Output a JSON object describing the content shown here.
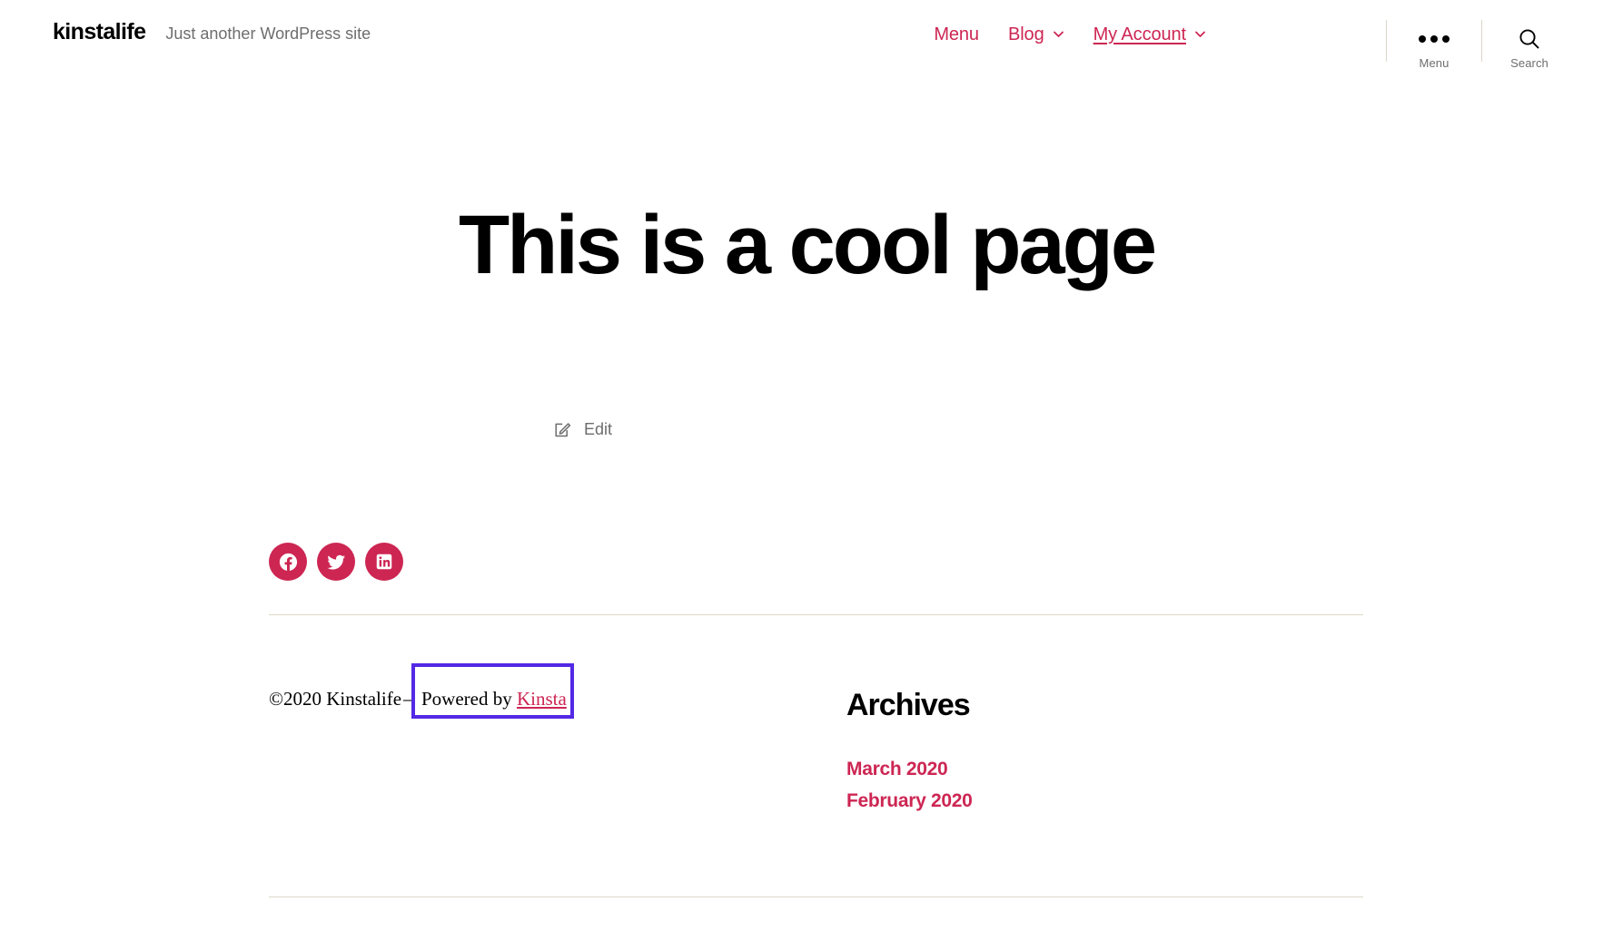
{
  "colors": {
    "accent": "#cd2653",
    "text": "#000000",
    "muted": "#6d6d6d",
    "rule": "#dcd7ca",
    "selection_box": "#5329e5",
    "background": "#ffffff"
  },
  "header": {
    "site_title": "kinstalife",
    "tagline": "Just another WordPress site",
    "nav": [
      {
        "label": "Menu",
        "has_chevron": false,
        "current": false,
        "icon": ""
      },
      {
        "label": "Blog",
        "has_chevron": true,
        "current": false,
        "icon": "chevron-down-icon"
      },
      {
        "label": "My Account",
        "has_chevron": true,
        "current": true,
        "icon": "chevron-down-icon"
      }
    ],
    "toggles": [
      {
        "label": "Menu",
        "icon": "ellipsis-icon"
      },
      {
        "label": "Search",
        "icon": "search-icon"
      }
    ]
  },
  "main": {
    "entry_title": "This is a cool page",
    "edit_link": {
      "label": "Edit",
      "icon": "edit-pencil-icon"
    }
  },
  "social": [
    {
      "name": "facebook",
      "label": "Facebook"
    },
    {
      "name": "twitter",
      "label": "Twitter"
    },
    {
      "name": "linkedin",
      "label": "LinkedIn"
    }
  ],
  "footer": {
    "copyright": "©2020 Kinstalife",
    "separator": "–",
    "powered_prefix": "Powered by ",
    "powered_link": "Kinsta"
  },
  "widget": {
    "title": "Archives",
    "items": [
      {
        "label": "March 2020"
      },
      {
        "label": "February 2020"
      }
    ]
  }
}
